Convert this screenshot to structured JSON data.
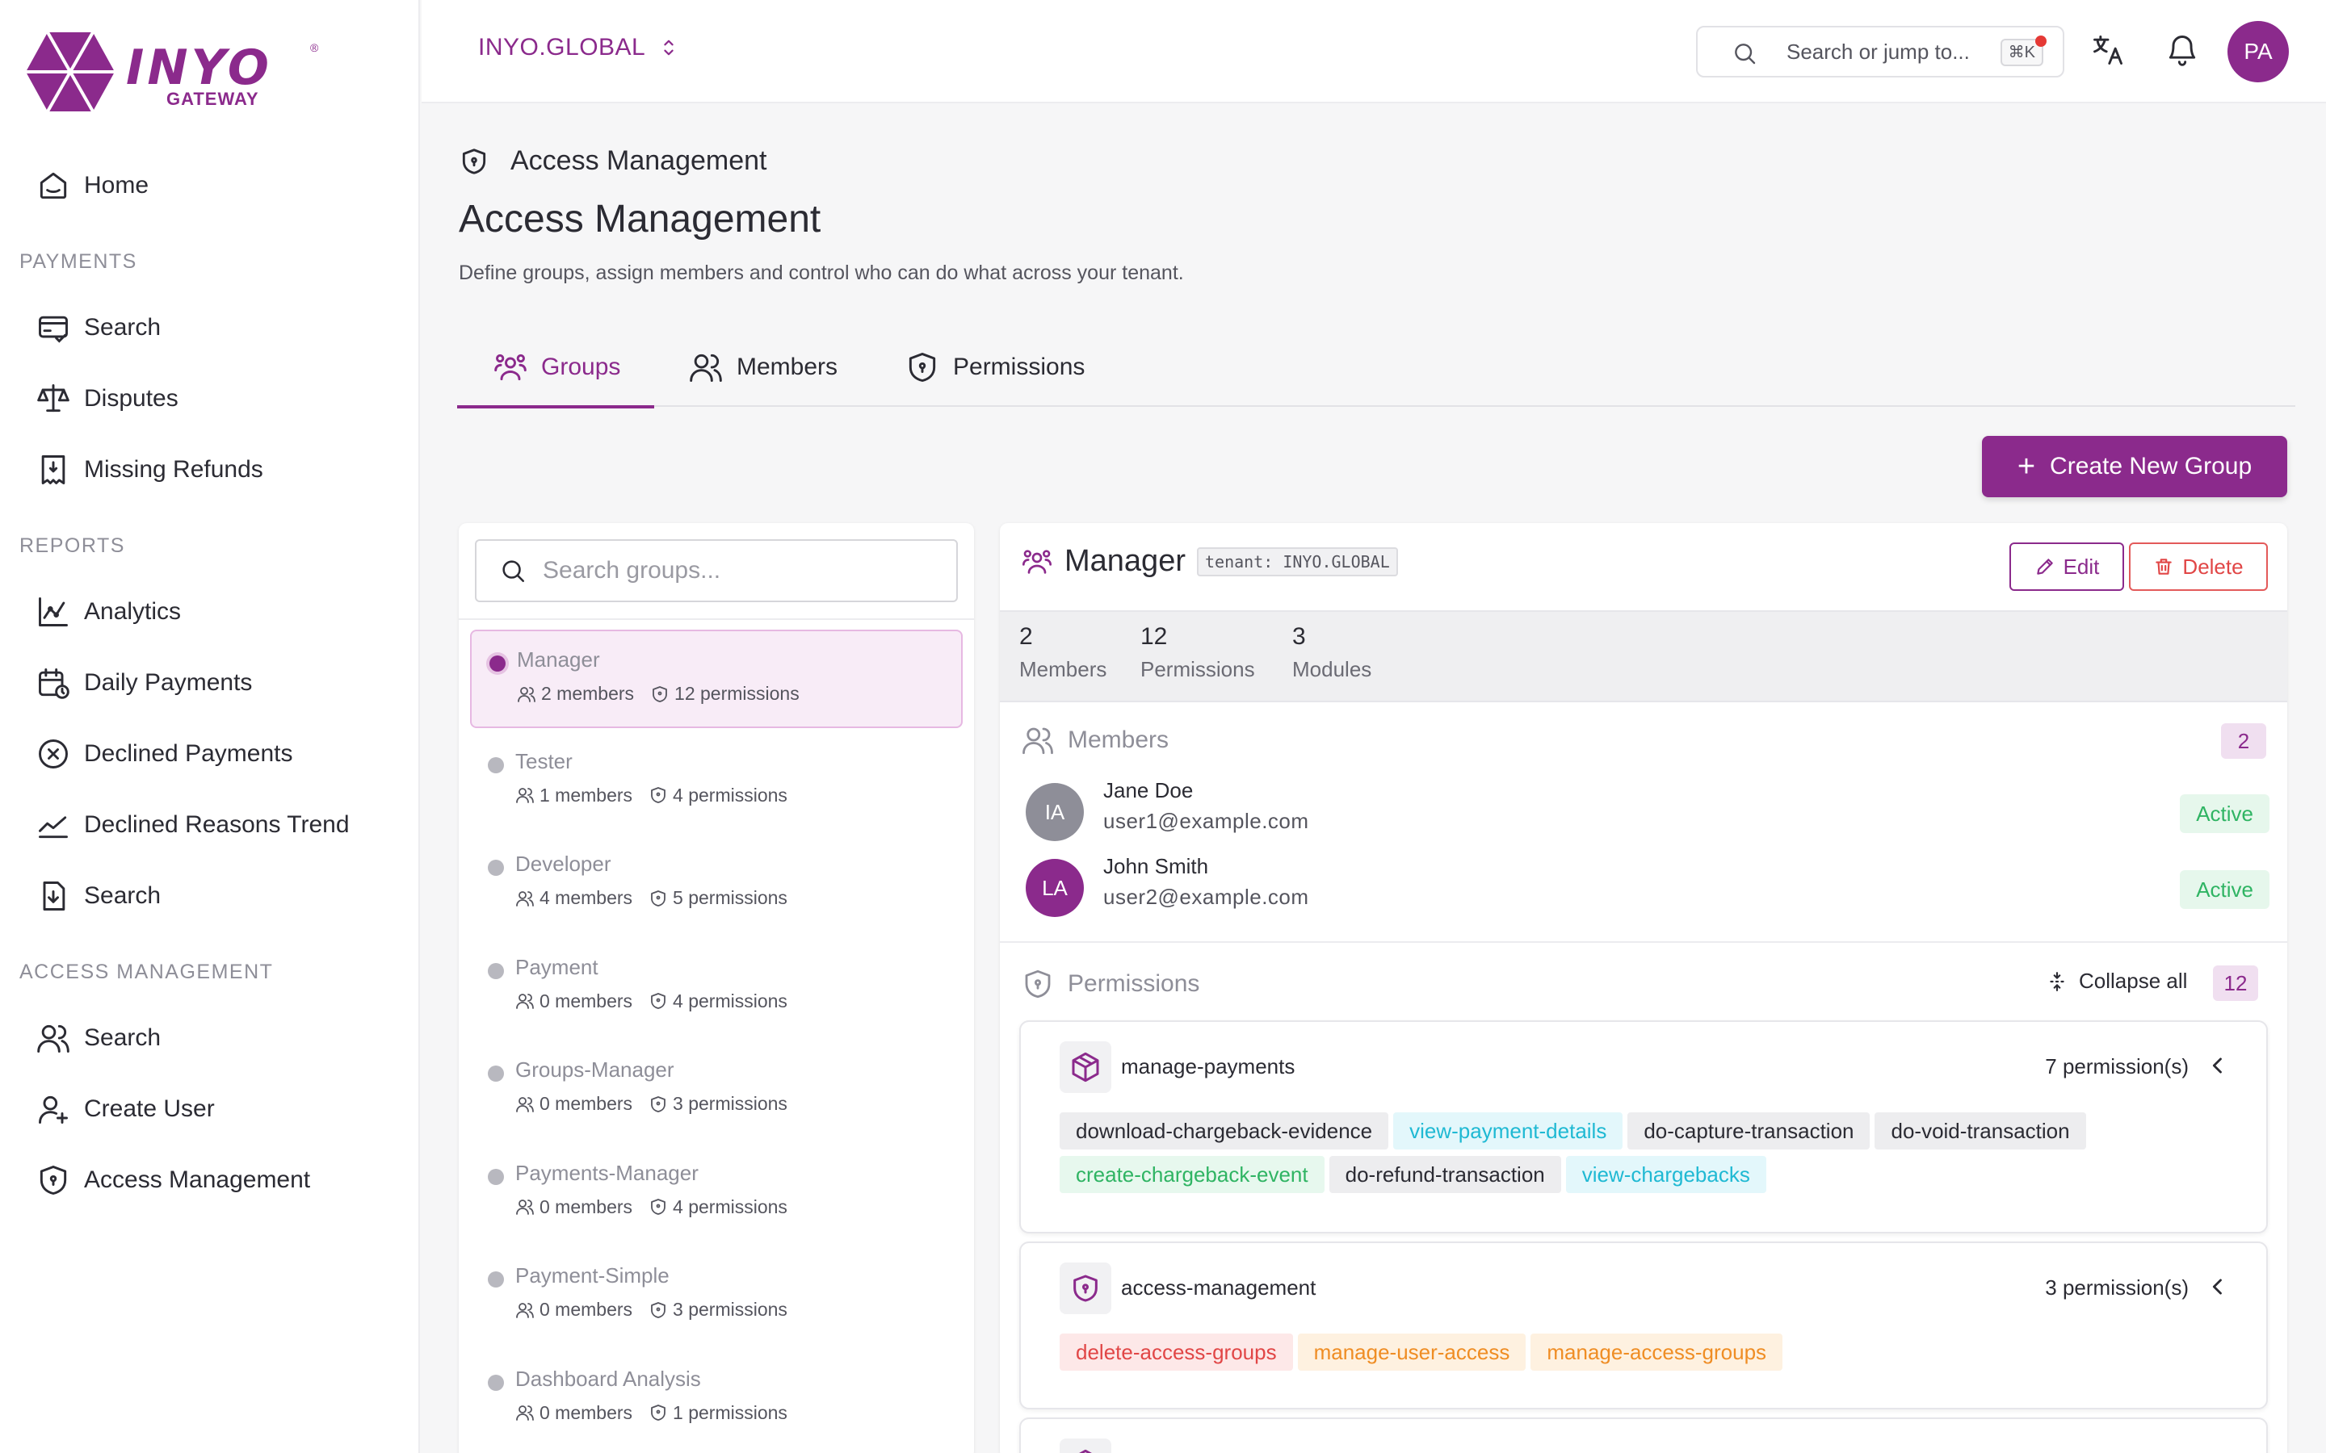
{
  "brand": {
    "name": "INYO",
    "sub": "GATEWAY",
    "reg": "®",
    "color": "#8b2a8c"
  },
  "sidebar": {
    "home": "Home",
    "sections": [
      {
        "title": "PAYMENTS",
        "items": [
          "Search",
          "Disputes",
          "Missing Refunds"
        ]
      },
      {
        "title": "REPORTS",
        "items": [
          "Analytics",
          "Daily Payments",
          "Declined Payments",
          "Declined Reasons Trend",
          "Search"
        ]
      },
      {
        "title": "ACCESS MANAGEMENT",
        "items": [
          "Search",
          "Create User",
          "Access Management"
        ]
      }
    ]
  },
  "topbar": {
    "tenant": "INYO.GLOBAL",
    "search_placeholder": "Search or jump to...",
    "shortcut": "⌘K",
    "avatar": "PA"
  },
  "page": {
    "breadcrumb": "Access Management",
    "title": "Access Management",
    "description": "Define groups, assign members and control who can do what across your tenant."
  },
  "tabs": [
    "Groups",
    "Members",
    "Permissions"
  ],
  "active_tab": "Groups",
  "create_button": "Create New Group",
  "groups_search_placeholder": "Search groups...",
  "groups": [
    {
      "name": "Manager",
      "members": "2 members",
      "permissions": "12 permissions"
    },
    {
      "name": "Tester",
      "members": "1 members",
      "permissions": "4 permissions"
    },
    {
      "name": "Developer",
      "members": "4 members",
      "permissions": "5 permissions"
    },
    {
      "name": "Payment",
      "members": "0 members",
      "permissions": "4 permissions"
    },
    {
      "name": "Groups-Manager",
      "members": "0 members",
      "permissions": "3 permissions"
    },
    {
      "name": "Payments-Manager",
      "members": "0 members",
      "permissions": "4 permissions"
    },
    {
      "name": "Payment-Simple",
      "members": "0 members",
      "permissions": "3 permissions"
    },
    {
      "name": "Dashboard Analysis",
      "members": "0 members",
      "permissions": "1 permissions"
    }
  ],
  "detail": {
    "name": "Manager",
    "tenant_tag": "tenant: INYO.GLOBAL",
    "edit": "Edit",
    "delete": "Delete",
    "stats": [
      {
        "num": "2",
        "label": "Members"
      },
      {
        "num": "12",
        "label": "Permissions"
      },
      {
        "num": "3",
        "label": "Modules"
      }
    ],
    "members_title": "Members",
    "members_count": "2",
    "members": [
      {
        "initials": "IA",
        "name": "Jane Doe",
        "email": "user1@example.com",
        "status": "Active",
        "color": "#8e8e98"
      },
      {
        "initials": "LA",
        "name": "John Smith",
        "email": "user2@example.com",
        "status": "Active",
        "color": "#8b2a8c"
      }
    ],
    "permissions_title": "Permissions",
    "collapse_all": "Collapse all",
    "permissions_count": "12",
    "modules": [
      {
        "name": "manage-payments",
        "count": "7 permission(s)",
        "icon": "cube-icon",
        "perms": [
          {
            "label": "download-chargeback-evidence",
            "tone": "gray"
          },
          {
            "label": "view-payment-details",
            "tone": "cyan"
          },
          {
            "label": "do-capture-transaction",
            "tone": "gray"
          },
          {
            "label": "do-void-transaction",
            "tone": "gray"
          },
          {
            "label": "create-chargeback-event",
            "tone": "green"
          },
          {
            "label": "do-refund-transaction",
            "tone": "gray"
          },
          {
            "label": "view-chargebacks",
            "tone": "cyan"
          }
        ]
      },
      {
        "name": "access-management",
        "count": "3 permission(s)",
        "icon": "shield-icon",
        "perms": [
          {
            "label": "delete-access-groups",
            "tone": "red"
          },
          {
            "label": "manage-user-access",
            "tone": "orange"
          },
          {
            "label": "manage-access-groups",
            "tone": "orange"
          }
        ]
      }
    ]
  }
}
